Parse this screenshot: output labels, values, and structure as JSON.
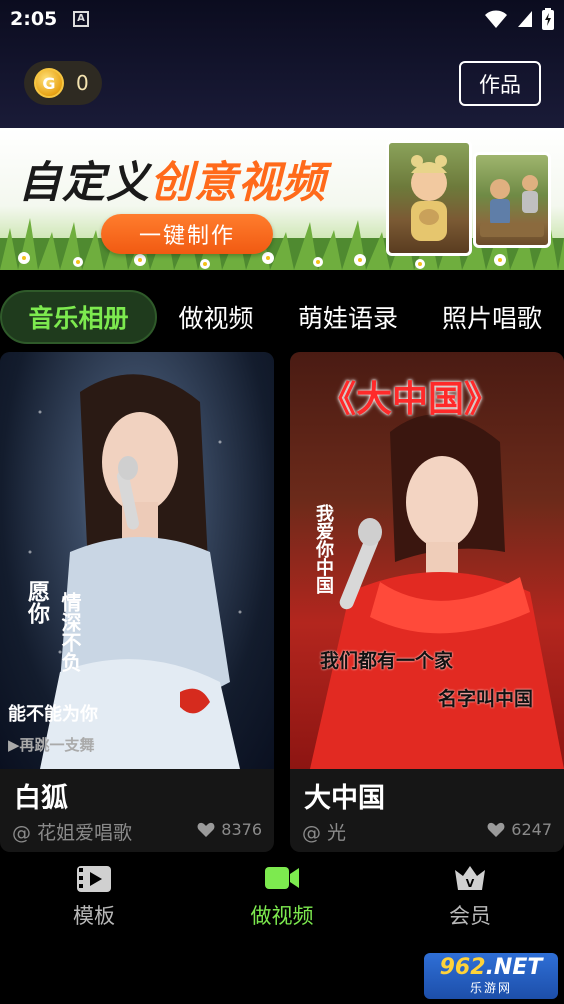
{
  "status": {
    "time": "2:05",
    "a_badge": "A"
  },
  "header": {
    "coin_symbol": "G",
    "coin_count": "0",
    "works_label": "作品"
  },
  "banner": {
    "title_part1": "自定义",
    "title_part2": "创意视频",
    "button_label": "一键制作"
  },
  "tabs": [
    {
      "label": "音乐相册"
    },
    {
      "label": "做视频"
    },
    {
      "label": "萌娃语录"
    },
    {
      "label": "照片唱歌"
    }
  ],
  "cards": [
    {
      "title": "白狐",
      "author": "@ 花姐爱唱歌",
      "likes": "8376",
      "overlay_lines": [
        "愿你",
        "情深不负",
        "能不能为你",
        "▶再跳一支舞"
      ]
    },
    {
      "title": "大中国",
      "author": "@ 光",
      "likes": "6247",
      "overlay_lines": [
        "《大中国》",
        "我爱你中国",
        "我们都有一个家",
        "名字叫中国"
      ]
    }
  ],
  "nav": [
    {
      "label": "模板"
    },
    {
      "label": "做视频"
    },
    {
      "label": "会员"
    }
  ],
  "watermark": {
    "top_left": "962",
    "top_right": ".NET",
    "bottom": "乐游网"
  },
  "colors": {
    "accent": "#7dea4f",
    "banner_button": "#f15a12",
    "coin": "#f6c642"
  }
}
